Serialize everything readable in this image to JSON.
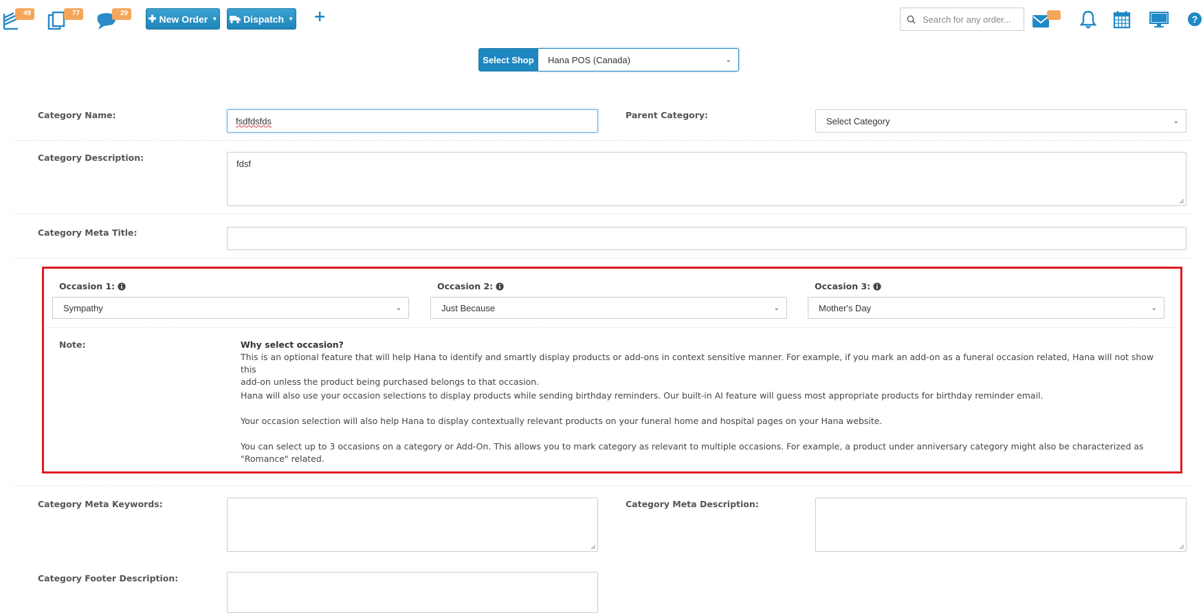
{
  "topbar": {
    "badges": {
      "orders": "49",
      "copies": "77",
      "messages": "29"
    },
    "new_order_label": "New Order",
    "dispatch_label": "Dispatch",
    "search_placeholder": "Search for any order..."
  },
  "shop": {
    "label": "Select Shop",
    "selected": "Hana POS (Canada)"
  },
  "form": {
    "category_name_label": "Category Name:",
    "category_name_value": "fsdfdsfds",
    "parent_category_label": "Parent Category:",
    "parent_category_value": "Select Category",
    "description_label": "Category Description:",
    "description_value": "fdsf",
    "meta_title_label": "Category Meta Title:",
    "meta_title_value": "",
    "meta_keywords_label": "Category Meta Keywords:",
    "meta_description_label": "Category Meta Description:",
    "footer_description_label": "Category Footer Description:"
  },
  "occasions": {
    "occ1_label": "Occasion 1:",
    "occ1_value": "Sympathy",
    "occ2_label": "Occasion 2:",
    "occ2_value": "Just Because",
    "occ3_label": "Occasion 3:",
    "occ3_value": "Mother's Day",
    "note_label": "Note:",
    "note_title": "Why select occasion?",
    "note_p1_line1": "This is an optional feature that will help Hana to identify and smartly display products or add-ons in context sensitive manner. For example, if you mark an add-on as a funeral occasion related, Hana will not show this",
    "note_p1_line2": "add-on unless the product being purchased belongs to that occasion.",
    "note_p2": "Hana will also use your occasion selections to display products while sending birthday reminders. Our built-in AI feature will guess most appropriate products for birthday reminder email.",
    "note_p3": "Your occasion selection will also help Hana to display contextually relevant products on your funeral home and hospital pages on your Hana website.",
    "note_p4_line1": "You can select up to 3 occasions on a category or Add-On. This allows you to mark category as relevant to multiple occasions. For example, a product under anniversary category might also be characterized as",
    "note_p4_line2": "\"Romance\" related."
  },
  "colors": {
    "primary_blue": "#1f88c0",
    "badge_orange": "#f5a65b",
    "highlight_red": "#e01a22"
  },
  "icons": [
    "orders-stack-icon",
    "copies-icon",
    "messages-icon",
    "plus-icon",
    "search-icon",
    "mail-icon",
    "bell-icon",
    "calendar-icon",
    "monitor-icon",
    "help-icon",
    "info-icon",
    "chevron-down-icon",
    "truck-icon"
  ]
}
